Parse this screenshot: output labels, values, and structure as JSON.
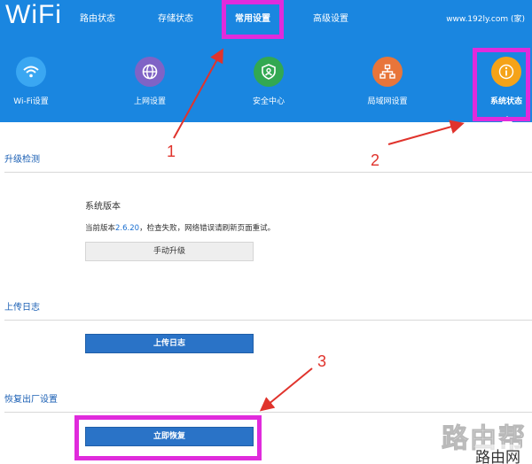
{
  "header": {
    "brand": "WiFi",
    "tabs": [
      {
        "label": "路由状态"
      },
      {
        "label": "存储状态"
      },
      {
        "label": "常用设置"
      },
      {
        "label": "高级设置"
      }
    ],
    "site": "www.192ly.com (家)"
  },
  "tiles": [
    {
      "label": "Wi-Fi设置",
      "icon": "wifi-icon",
      "color": "#3aa7f2"
    },
    {
      "label": "上网设置",
      "icon": "globe-icon",
      "color": "#7f63c6"
    },
    {
      "label": "安全中心",
      "icon": "shield-icon",
      "color": "#32a852"
    },
    {
      "label": "局域网设置",
      "icon": "network-icon",
      "color": "#e8753a"
    },
    {
      "label": "系统状态",
      "icon": "info-icon",
      "color": "#f5a319"
    }
  ],
  "upgrade": {
    "title": "升级检测",
    "label": "系统版本",
    "status_prefix": "当前版本",
    "version": "2.6.20",
    "status_suffix": "，检查失败，网络错误请刷新页面重试。",
    "button": "手动升级"
  },
  "log": {
    "title": "上传日志",
    "button": "上传日志"
  },
  "reset": {
    "title": "恢复出厂设置",
    "button": "立即恢复"
  },
  "annotations": [
    "1",
    "2",
    "3"
  ],
  "watermark": {
    "big": "路由帮",
    "small": "路由网"
  },
  "colors": {
    "header": "#1a86e0",
    "highlight": "#e02bdc",
    "arrow": "#e0332c",
    "primary_button": "#2a73c7"
  }
}
